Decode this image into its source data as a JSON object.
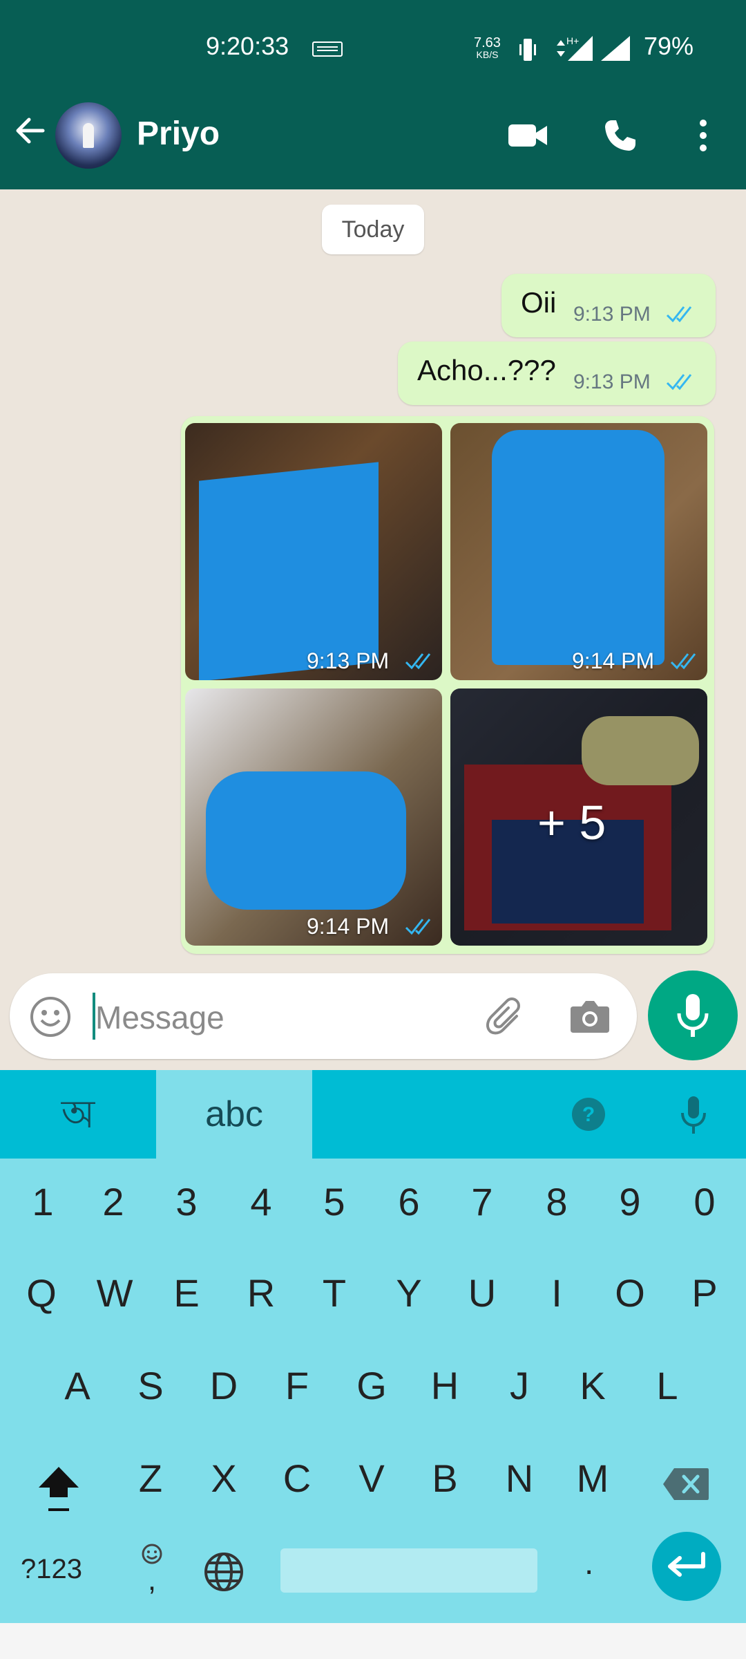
{
  "status_bar": {
    "time": "9:20:33",
    "net_speed_value": "7.63",
    "net_speed_unit": "KB/S",
    "battery": "79%",
    "icons": [
      "keyboard-icon",
      "vibrate-icon",
      "signal-h-plus-icon",
      "signal-icon"
    ]
  },
  "header": {
    "contact_name": "Priyo",
    "icons": [
      "back-arrow-icon",
      "avatar",
      "video-call-icon",
      "voice-call-icon",
      "more-options-icon"
    ]
  },
  "chat": {
    "date_chip": "Today",
    "messages": [
      {
        "text": "Oii",
        "time": "9:13 PM",
        "status": "read"
      },
      {
        "text": "Acho...???",
        "time": "9:13 PM",
        "status": "read"
      }
    ],
    "gallery": {
      "photos": [
        {
          "time": "9:13 PM",
          "status": "read"
        },
        {
          "time": "9:14 PM",
          "status": "read"
        },
        {
          "time": "9:14 PM",
          "status": "read"
        },
        {
          "more_label": "+ 5"
        }
      ]
    }
  },
  "input": {
    "placeholder": "Message",
    "icons": [
      "emoji-icon",
      "attach-icon",
      "camera-icon",
      "mic-icon"
    ]
  },
  "keyboard": {
    "tab_bengali": "অ",
    "tab_abc": "abc",
    "row_numbers": [
      "1",
      "2",
      "3",
      "4",
      "5",
      "6",
      "7",
      "8",
      "9",
      "0"
    ],
    "row_1": [
      "Q",
      "W",
      "E",
      "R",
      "T",
      "Y",
      "U",
      "I",
      "O",
      "P"
    ],
    "row_2": [
      "A",
      "S",
      "D",
      "F",
      "G",
      "H",
      "J",
      "K",
      "L"
    ],
    "row_3": [
      "Z",
      "X",
      "C",
      "V",
      "B",
      "N",
      "M"
    ],
    "symbols_key": "?123",
    "comma_key": ",",
    "period_key": "."
  },
  "colors": {
    "header_green": "#075e54",
    "bubble_green": "#dcf8c6",
    "read_tick_blue": "#34b7f1",
    "mic_green": "#00a884",
    "keyboard_teal": "#00bcd4",
    "keyboard_light": "#80deea"
  }
}
